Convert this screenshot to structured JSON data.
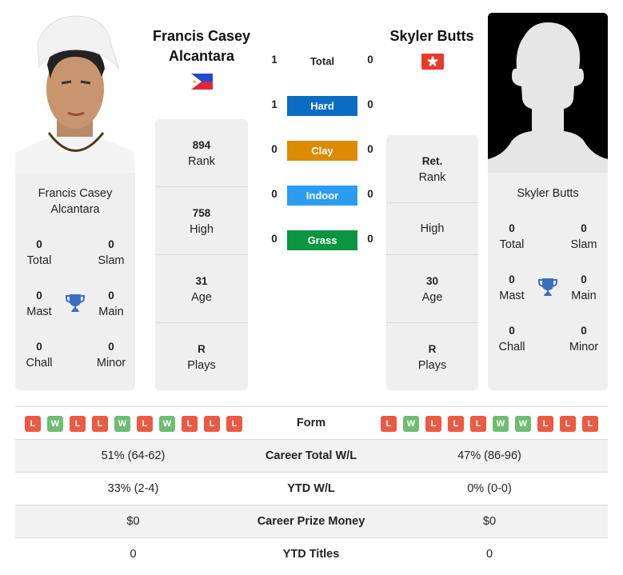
{
  "player1": {
    "name": "Francis Casey Alcantara",
    "name_line1": "Francis Casey",
    "name_line2": "Alcantara",
    "flag": "philippines-flag",
    "rank": {
      "value": "894",
      "label": "Rank"
    },
    "high": {
      "value": "758",
      "label": "High"
    },
    "age": {
      "value": "31",
      "label": "Age"
    },
    "plays": {
      "value": "R",
      "label": "Plays"
    },
    "titles": {
      "total": {
        "value": "0",
        "label": "Total"
      },
      "slam": {
        "value": "0",
        "label": "Slam"
      },
      "mast": {
        "value": "0",
        "label": "Mast"
      },
      "main": {
        "value": "0",
        "label": "Main"
      },
      "chall": {
        "value": "0",
        "label": "Chall"
      },
      "minor": {
        "value": "0",
        "label": "Minor"
      }
    },
    "form": [
      "L",
      "W",
      "L",
      "L",
      "W",
      "L",
      "W",
      "L",
      "L",
      "L"
    ]
  },
  "player2": {
    "name": "Skyler Butts",
    "flag": "hong-kong-flag",
    "rank": {
      "value": "Ret.",
      "label": "Rank"
    },
    "high": {
      "value": "",
      "label": "High"
    },
    "age": {
      "value": "30",
      "label": "Age"
    },
    "plays": {
      "value": "R",
      "label": "Plays"
    },
    "titles": {
      "total": {
        "value": "0",
        "label": "Total"
      },
      "slam": {
        "value": "0",
        "label": "Slam"
      },
      "mast": {
        "value": "0",
        "label": "Mast"
      },
      "main": {
        "value": "0",
        "label": "Main"
      },
      "chall": {
        "value": "0",
        "label": "Chall"
      },
      "minor": {
        "value": "0",
        "label": "Minor"
      }
    },
    "form": [
      "L",
      "W",
      "L",
      "L",
      "L",
      "W",
      "W",
      "L",
      "L",
      "L"
    ]
  },
  "h2h": [
    {
      "label": "Total",
      "p1": "1",
      "p2": "0",
      "color": ""
    },
    {
      "label": "Hard",
      "p1": "1",
      "p2": "0",
      "color": "#0a6cc4"
    },
    {
      "label": "Clay",
      "p1": "0",
      "p2": "0",
      "color": "#dd8b00"
    },
    {
      "label": "Indoor",
      "p1": "0",
      "p2": "0",
      "color": "#2b9cf0"
    },
    {
      "label": "Grass",
      "p1": "0",
      "p2": "0",
      "color": "#0b9540"
    }
  ],
  "table": {
    "form_label": "Form",
    "rows": [
      {
        "label": "Career Total W/L",
        "p1": "51% (64-62)",
        "p2": "47% (86-96)"
      },
      {
        "label": "YTD W/L",
        "p1": "33% (2-4)",
        "p2": "0% (0-0)"
      },
      {
        "label": "Career Prize Money",
        "p1": "$0",
        "p2": "$0"
      },
      {
        "label": "YTD Titles",
        "p1": "0",
        "p2": "0"
      }
    ]
  },
  "colors": {
    "loss": "#eb5a43",
    "win": "#6fbd73",
    "trophy": "#3a6fbf"
  }
}
